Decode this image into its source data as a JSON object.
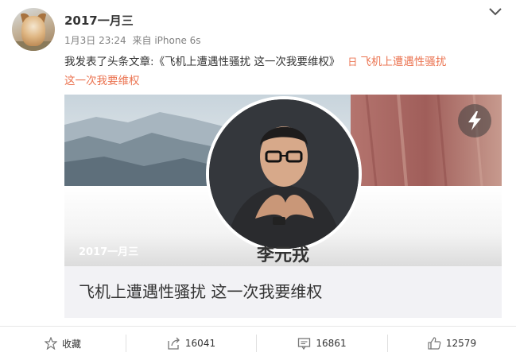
{
  "post": {
    "username": "2017一月三",
    "timestamp": "1月3日 23:24",
    "source": "来自 iPhone 6s",
    "text_prefix": "我发表了头条文章:",
    "article_link": "《飞机上遭遇性骚扰 这一次我要维权》",
    "link_icon": "日",
    "link_text_line1": "飞机上遭遇性骚扰",
    "link_text_line2": "这一次我要维权"
  },
  "card": {
    "cover_username": "2017一月三",
    "cover_name": "李元戎",
    "title": "飞机上遭遇性骚扰 这一次我要维权"
  },
  "actions": {
    "favorite_label": "收藏",
    "share_count": "16041",
    "comment_count": "16861",
    "like_count": "12579"
  },
  "icons": [
    "chevron-down-icon",
    "flash-icon",
    "star-icon",
    "share-icon",
    "comment-icon",
    "like-icon",
    "article-icon"
  ],
  "colors": {
    "link": "#eb7350",
    "text": "#333333",
    "muted": "#808080"
  }
}
